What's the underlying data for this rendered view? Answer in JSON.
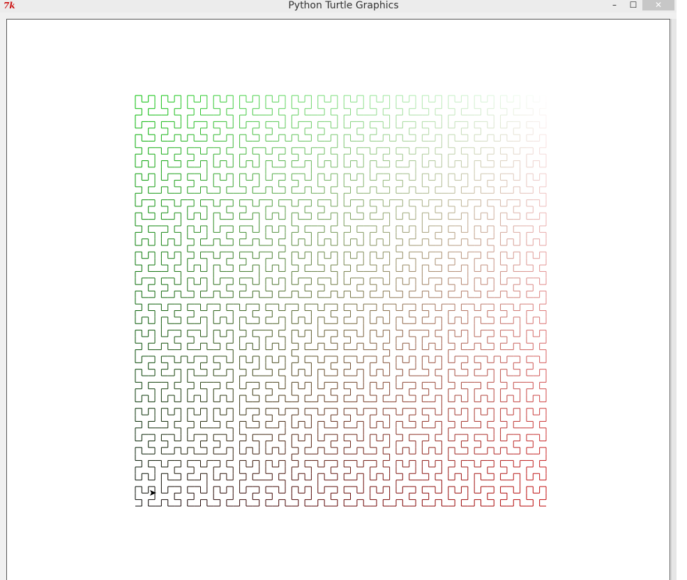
{
  "window": {
    "title": "Python Turtle Graphics",
    "icon": "tk-feather-icon",
    "icon_text": "7k",
    "controls": {
      "minimize": "–",
      "maximize": "☐",
      "close": "✕"
    }
  },
  "canvas": {
    "background": "#ffffff",
    "curve": "hilbert",
    "order": 6,
    "gradient": {
      "bottom_left": "#000000",
      "top_left": "#00c000",
      "bottom_right": "#c00000",
      "top_right": "#ffffff"
    }
  },
  "turtle": {
    "shape": "arrow",
    "color": "#000000"
  }
}
